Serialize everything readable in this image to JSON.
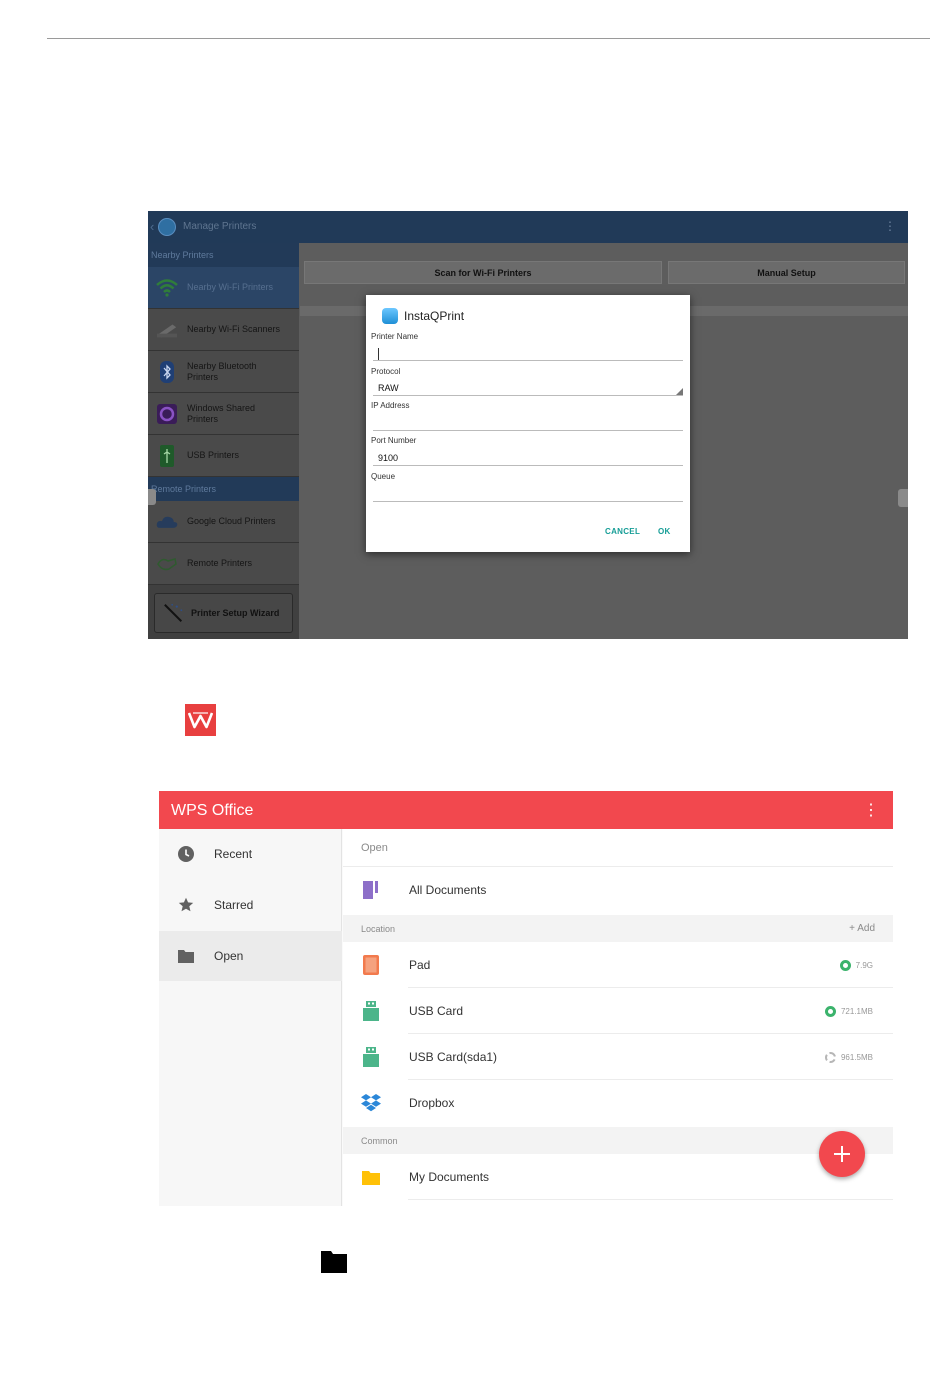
{
  "manage_printers": {
    "title": "Manage Printers",
    "nearby_header": "Nearby Printers",
    "remote_header": "Remote Printers",
    "nearby_items": [
      {
        "label": "Nearby Wi-Fi Printers",
        "icon": "wifi-icon"
      },
      {
        "label": "Nearby Wi-Fi Scanners",
        "icon": "scanner-icon"
      },
      {
        "label": "Nearby Bluetooth Printers",
        "icon": "bluetooth-icon"
      },
      {
        "label": "Windows Shared Printers",
        "icon": "windows-share-icon"
      },
      {
        "label": "USB Printers",
        "icon": "usb-icon"
      }
    ],
    "remote_items": [
      {
        "label": "Google Cloud Printers",
        "icon": "cloud-icon"
      },
      {
        "label": "Remote Printers",
        "icon": "remote-icon"
      }
    ],
    "wizard_label": "Printer Setup Wizard",
    "scan_button": "Scan for Wi-Fi Printers",
    "manual_button": "Manual Setup",
    "dialog": {
      "title": "InstaQPrint",
      "printer_name_label": "Printer Name",
      "printer_name_value": "",
      "protocol_label": "Protocol",
      "protocol_value": "RAW",
      "ip_label": "IP Address",
      "ip_value": "",
      "port_label": "Port Number",
      "port_value": "9100",
      "queue_label": "Queue",
      "queue_value": "",
      "cancel": "CANCEL",
      "ok": "OK"
    }
  },
  "wps": {
    "title": "WPS Office",
    "accent": "#f2484e",
    "nav": [
      {
        "label": "Recent",
        "icon": "clock-icon"
      },
      {
        "label": "Starred",
        "icon": "star-icon"
      },
      {
        "label": "Open",
        "icon": "folder-icon"
      }
    ],
    "open_header": "Open",
    "all_documents": "All Documents",
    "location_header": "Location",
    "add_label": "+ Add",
    "locations": [
      {
        "label": "Pad",
        "size": "7.9G"
      },
      {
        "label": "USB Card",
        "size": "721.1MB"
      },
      {
        "label": "USB Card(sda1)",
        "size": "961.5MB"
      },
      {
        "label": "Dropbox",
        "size": ""
      }
    ],
    "common_header": "Common",
    "common": [
      {
        "label": "My Documents"
      }
    ]
  }
}
